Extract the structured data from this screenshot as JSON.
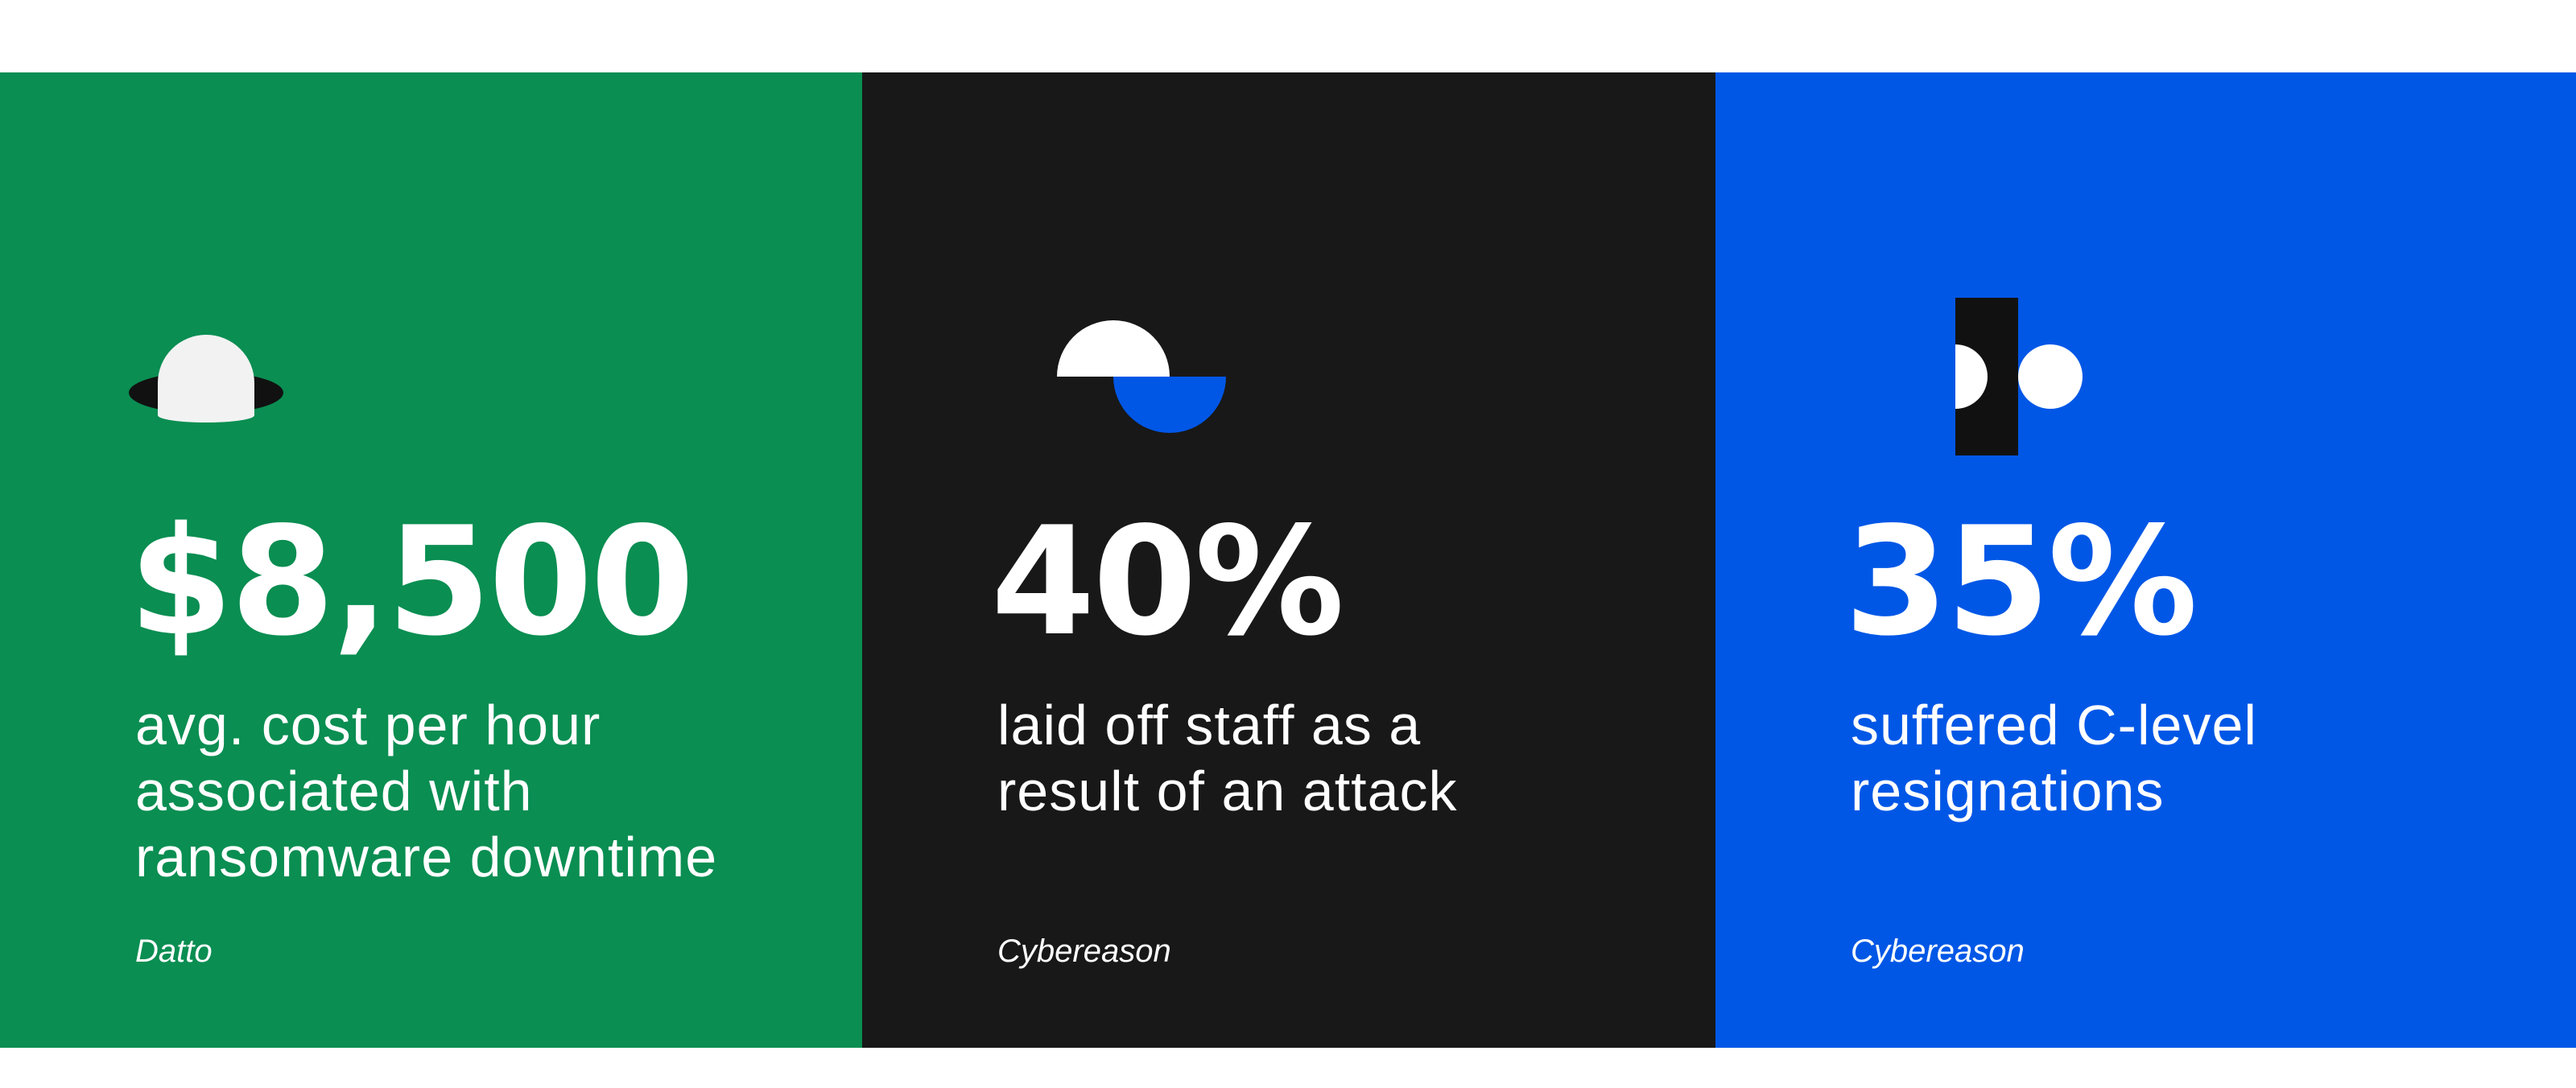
{
  "colors": {
    "panel_green": "#0a8e52",
    "panel_dark": "#181818",
    "panel_blue": "#0057e6",
    "icon_white": "#f2f2f2",
    "icon_black": "#111111",
    "icon_blue": "#0057e6"
  },
  "stats": [
    {
      "value": "$8,500",
      "description_lines": [
        "avg. cost per hour",
        "associated with",
        "ransomware downtime"
      ],
      "source": "Datto",
      "icon": "dome-shadow-icon"
    },
    {
      "value": "40%",
      "description_lines": [
        "laid off staff as a",
        "result of an attack"
      ],
      "source": "Cybereason",
      "icon": "split-semicircles-icon"
    },
    {
      "value": "35%",
      "description_lines": [
        "suffered C-level",
        "resignations"
      ],
      "source": "Cybereason",
      "icon": "bar-circles-icon"
    }
  ]
}
